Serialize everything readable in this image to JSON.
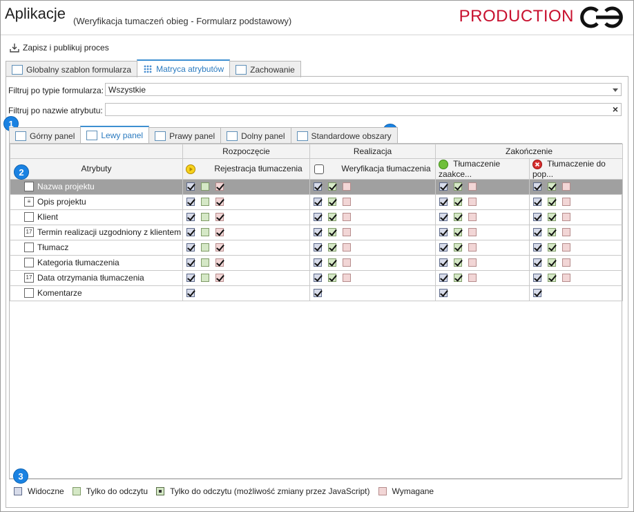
{
  "app": {
    "title": "Aplikacje",
    "subtitle": "(Weryfikacja tumaczeń obieg - Formularz podstawowy)",
    "env": "PRODUCTION"
  },
  "toolbar": {
    "publish_label": "Zapisz i publikuj proces"
  },
  "main_tabs": [
    {
      "label": "Globalny szablon formularza"
    },
    {
      "label": "Matryca atrybutów"
    },
    {
      "label": "Zachowanie"
    }
  ],
  "filters": {
    "form_type_label": "Filtruj po typie formularza:",
    "form_type_value": "Wszystkie",
    "attr_name_label": "Filtruj po nazwie atrybutu:",
    "attr_name_value": ""
  },
  "panel_tabs": [
    {
      "label": "Górny panel"
    },
    {
      "label": "Lewy panel"
    },
    {
      "label": "Prawy panel"
    },
    {
      "label": "Dolny panel"
    },
    {
      "label": "Standardowe obszary"
    }
  ],
  "badges": [
    "1",
    "2",
    "3",
    "4"
  ],
  "matrix": {
    "attributes_header": "Atrybuty",
    "stages": [
      {
        "name": "Rozpoczęcie"
      },
      {
        "name": "Realizacja"
      },
      {
        "name": "Zakończenie"
      }
    ],
    "steps": [
      {
        "name": "Rejestracja tłumaczenia",
        "icon": "play-icon"
      },
      {
        "name": "Weryfikacja tłumaczenia",
        "icon": "task-icon"
      },
      {
        "name": "Tłumaczenie zaakce...",
        "icon": "stop-icon"
      },
      {
        "name": "Tłumaczenie do pop...",
        "icon": "reject-icon"
      }
    ],
    "rows": [
      {
        "name": "Nazwa projektu",
        "icon": "text-field-icon",
        "selected": true
      },
      {
        "name": "Opis projektu",
        "icon": "multiline-text-icon"
      },
      {
        "name": "Klient",
        "icon": "text-field-icon"
      },
      {
        "name": "Termin realizacji uzgodniony z klientem",
        "icon": "calendar-icon"
      },
      {
        "name": "Tłumacz",
        "icon": "text-field-icon"
      },
      {
        "name": "Kategoria tłumaczenia",
        "icon": "text-field-icon"
      },
      {
        "name": "Data otrzymania tłumaczenia",
        "icon": "calendar-icon"
      },
      {
        "name": "Komentarze",
        "icon": "comment-icon"
      }
    ]
  },
  "legend": [
    {
      "label": "Widoczne"
    },
    {
      "label": "Tylko do odczytu"
    },
    {
      "label": "Tylko do odczytu (możliwość zmiany przez JavaScript)"
    },
    {
      "label": "Wymagane"
    }
  ]
}
